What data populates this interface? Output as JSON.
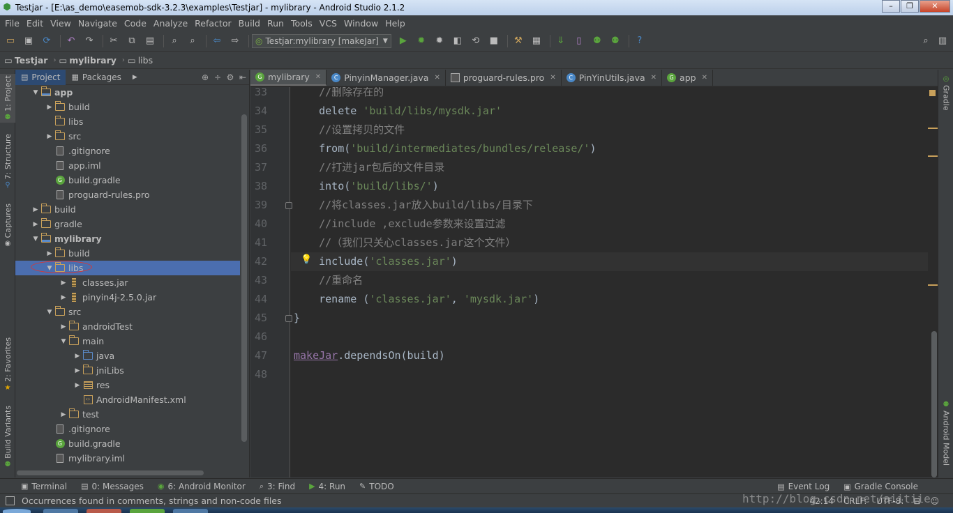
{
  "window": {
    "title": "Testjar - [E:\\as_demo\\easemob-sdk-3.2.3\\examples\\Testjar] - mylibrary - Android Studio 2.1.2",
    "controls": [
      "–",
      "❐",
      "✕"
    ]
  },
  "menu": [
    "File",
    "Edit",
    "View",
    "Navigate",
    "Code",
    "Analyze",
    "Refactor",
    "Build",
    "Run",
    "Tools",
    "VCS",
    "Window",
    "Help"
  ],
  "toolbar": {
    "run_config": "Testjar:mylibrary [makeJar]"
  },
  "breadcrumb": [
    "Testjar",
    "mylibrary",
    "libs"
  ],
  "left_strip": {
    "project": "1: Project",
    "structure": "7: Structure",
    "captures": "Captures",
    "favorites": "2: Favorites",
    "build_variants": "Build Variants"
  },
  "right_strip": {
    "gradle": "Gradle",
    "android_model": "Android Model"
  },
  "project_panel": {
    "tabs": [
      "Project",
      "Packages"
    ],
    "tree": [
      {
        "label": "app",
        "depth": 1,
        "arrow": "down",
        "icon": "module",
        "bold": true
      },
      {
        "label": "build",
        "depth": 2,
        "arrow": "right",
        "icon": "folder"
      },
      {
        "label": "libs",
        "depth": 2,
        "arrow": "none",
        "icon": "folder"
      },
      {
        "label": "src",
        "depth": 2,
        "arrow": "right",
        "icon": "folder"
      },
      {
        "label": ".gitignore",
        "depth": 2,
        "arrow": "none",
        "icon": "file"
      },
      {
        "label": "app.iml",
        "depth": 2,
        "arrow": "none",
        "icon": "file"
      },
      {
        "label": "build.gradle",
        "depth": 2,
        "arrow": "none",
        "icon": "gradle"
      },
      {
        "label": "proguard-rules.pro",
        "depth": 2,
        "arrow": "none",
        "icon": "file"
      },
      {
        "label": "build",
        "depth": 1,
        "arrow": "right",
        "icon": "folder"
      },
      {
        "label": "gradle",
        "depth": 1,
        "arrow": "right",
        "icon": "folder"
      },
      {
        "label": "mylibrary",
        "depth": 1,
        "arrow": "down",
        "icon": "module",
        "bold": true
      },
      {
        "label": "build",
        "depth": 2,
        "arrow": "right",
        "icon": "folder"
      },
      {
        "label": "libs",
        "depth": 2,
        "arrow": "down",
        "icon": "folder",
        "selected": true
      },
      {
        "label": "classes.jar",
        "depth": 3,
        "arrow": "right",
        "icon": "jar"
      },
      {
        "label": "pinyin4j-2.5.0.jar",
        "depth": 3,
        "arrow": "right",
        "icon": "jar"
      },
      {
        "label": "src",
        "depth": 2,
        "arrow": "down",
        "icon": "folder"
      },
      {
        "label": "androidTest",
        "depth": 3,
        "arrow": "right",
        "icon": "folder"
      },
      {
        "label": "main",
        "depth": 3,
        "arrow": "down",
        "icon": "folder"
      },
      {
        "label": "java",
        "depth": 4,
        "arrow": "right",
        "icon": "src"
      },
      {
        "label": "jniLibs",
        "depth": 4,
        "arrow": "right",
        "icon": "folder"
      },
      {
        "label": "res",
        "depth": 4,
        "arrow": "right",
        "icon": "res"
      },
      {
        "label": "AndroidManifest.xml",
        "depth": 4,
        "arrow": "none",
        "icon": "xml"
      },
      {
        "label": "test",
        "depth": 3,
        "arrow": "right",
        "icon": "folder"
      },
      {
        "label": ".gitignore",
        "depth": 2,
        "arrow": "none",
        "icon": "file"
      },
      {
        "label": "build.gradle",
        "depth": 2,
        "arrow": "none",
        "icon": "gradle"
      },
      {
        "label": "mylibrary.iml",
        "depth": 2,
        "arrow": "none",
        "icon": "file"
      }
    ]
  },
  "editor": {
    "tabs": [
      {
        "label": "mylibrary",
        "icon": "gradle",
        "active": true
      },
      {
        "label": "PinyinManager.java",
        "icon": "java"
      },
      {
        "label": "proguard-rules.pro",
        "icon": "pro"
      },
      {
        "label": "PinYinUtils.java",
        "icon": "java"
      },
      {
        "label": "app",
        "icon": "gradle"
      }
    ],
    "lines": [
      {
        "n": "33",
        "segs": [
          {
            "t": "    //删除存在的",
            "c": "c"
          }
        ]
      },
      {
        "n": "34",
        "segs": [
          {
            "t": "    delete ",
            "c": "d"
          },
          {
            "t": "'build/libs/mysdk.jar'",
            "c": "s"
          }
        ]
      },
      {
        "n": "35",
        "segs": [
          {
            "t": "    //设置拷贝的文件",
            "c": "c"
          }
        ]
      },
      {
        "n": "36",
        "segs": [
          {
            "t": "    from(",
            "c": "d"
          },
          {
            "t": "'build/intermediates/bundles/release/'",
            "c": "s"
          },
          {
            "t": ")",
            "c": "d"
          }
        ]
      },
      {
        "n": "37",
        "segs": [
          {
            "t": "    //打进jar包后的文件目录",
            "c": "c"
          }
        ]
      },
      {
        "n": "38",
        "segs": [
          {
            "t": "    into(",
            "c": "d"
          },
          {
            "t": "'build/libs/'",
            "c": "s"
          },
          {
            "t": ")",
            "c": "d"
          }
        ]
      },
      {
        "n": "39",
        "segs": [
          {
            "t": "    //将classes.jar放入build/libs/目录下",
            "c": "c"
          }
        ]
      },
      {
        "n": "40",
        "segs": [
          {
            "t": "    //include ,exclude参数来设置过滤",
            "c": "c"
          }
        ]
      },
      {
        "n": "41",
        "segs": [
          {
            "t": "    //（我们只关心classes.jar这个文件）",
            "c": "c"
          }
        ]
      },
      {
        "n": "42",
        "segs": [
          {
            "t": "    include(",
            "c": "d"
          },
          {
            "t": "'classes.jar'",
            "c": "s"
          },
          {
            "t": ")",
            "c": "d"
          }
        ],
        "current": true
      },
      {
        "n": "43",
        "segs": [
          {
            "t": "    //重命名",
            "c": "c"
          }
        ]
      },
      {
        "n": "44",
        "segs": [
          {
            "t": "    rename (",
            "c": "d"
          },
          {
            "t": "'classes.jar'",
            "c": "s"
          },
          {
            "t": ", ",
            "c": "d"
          },
          {
            "t": "'mysdk.jar'",
            "c": "s"
          },
          {
            "t": ")",
            "c": "d"
          }
        ]
      },
      {
        "n": "45",
        "segs": [
          {
            "t": "}",
            "c": "d"
          }
        ]
      },
      {
        "n": "46",
        "segs": [
          {
            "t": "",
            "c": "d"
          }
        ]
      },
      {
        "n": "47",
        "segs": [
          {
            "t": "makeJar",
            "c": "u"
          },
          {
            "t": ".dependsOn(build)",
            "c": "d"
          }
        ]
      },
      {
        "n": "48",
        "segs": [
          {
            "t": "",
            "c": "d"
          }
        ]
      }
    ]
  },
  "bottom_tools": {
    "left": [
      {
        "label": "Terminal",
        "icon": "▣"
      },
      {
        "label": "0: Messages",
        "icon": "▤"
      },
      {
        "label": "6: Android Monitor",
        "icon": "◉"
      },
      {
        "label": "3: Find",
        "icon": "⌕"
      },
      {
        "label": "4: Run",
        "icon": "▶"
      },
      {
        "label": "TODO",
        "icon": "✎"
      }
    ],
    "right": [
      {
        "label": "Event Log",
        "icon": "▤"
      },
      {
        "label": "Gradle Console",
        "icon": "▣"
      }
    ]
  },
  "status": {
    "message": "Occurrences found in comments, strings and non-code files",
    "position": "42:14",
    "line_sep": "CRLF:",
    "encoding": "UTF-8:"
  },
  "watermark": "http://blog.csdn.net/aiitiie",
  "colors": {
    "selection": "#4b6eaf",
    "string": "#6a8759",
    "comment": "#808080",
    "annotation_circle": "#d23a3a"
  }
}
